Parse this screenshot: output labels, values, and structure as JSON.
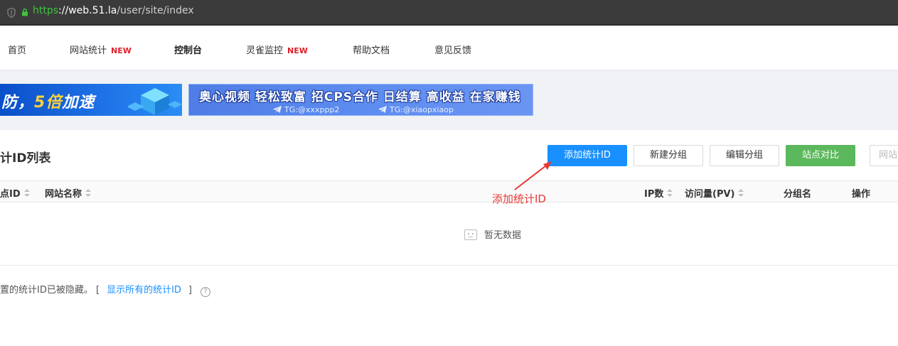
{
  "browser": {
    "url_scheme": "https",
    "url_host": "://web.51.la",
    "url_path": "/user/site/index"
  },
  "nav": {
    "items": [
      {
        "label": "首页",
        "badge": ""
      },
      {
        "label": "网站统计",
        "badge": "NEW"
      },
      {
        "label": "控制台",
        "badge": ""
      },
      {
        "label": "灵雀监控",
        "badge": "NEW"
      },
      {
        "label": "帮助文档",
        "badge": ""
      },
      {
        "label": "意见反馈",
        "badge": ""
      }
    ]
  },
  "banners": {
    "left": {
      "text_prefix": "防，",
      "text_highlight": "5倍",
      "text_suffix": "加速"
    },
    "right": {
      "headline": "奥心视频  轻松致富  招CPS合作  日结算  高收益  在家赚钱",
      "tg1": "TG:@xxxppp2",
      "tg2": "TG:@xiaopxiaop"
    }
  },
  "page": {
    "title": "计ID列表",
    "buttons": {
      "add": "添加统计ID",
      "new_group": "新建分组",
      "edit_group": "编辑分组",
      "compare": "站点对比",
      "partial": "网站"
    },
    "table": {
      "columns": [
        "点ID",
        "网站名称",
        "IP数",
        "访问量(PV)",
        "分组名",
        "操作"
      ],
      "empty_text": "暂无数据"
    },
    "hidden_note": {
      "text": "置的统计ID已被隐藏。 [",
      "link": "显示所有的统计ID",
      "close_bracket": "]",
      "help": "?"
    }
  },
  "annotation": {
    "label": "添加统计ID",
    "color": "#e53935"
  },
  "colors": {
    "primary": "#1890ff",
    "success": "#5cb85c",
    "new_badge": "#e0202a"
  }
}
